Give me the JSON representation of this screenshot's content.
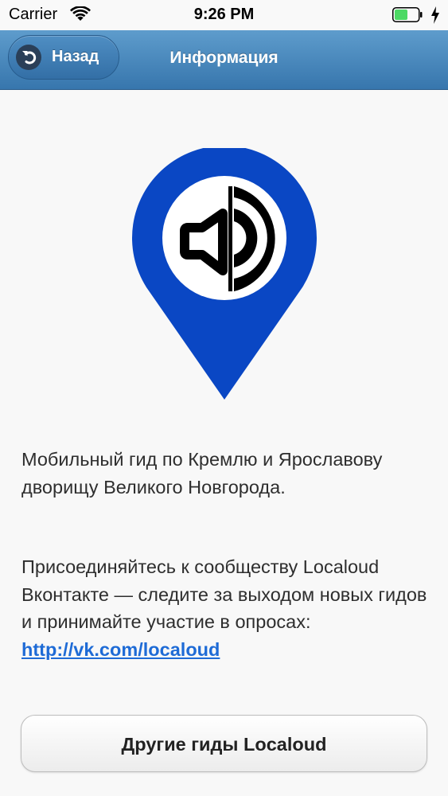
{
  "status_bar": {
    "carrier": "Carrier",
    "time": "9:26 PM",
    "battery_color": "#4cd964"
  },
  "nav": {
    "back_label": "Назад",
    "title": "Информация",
    "bar_color": "#3f7fb6"
  },
  "logo": {
    "pin_color": "#0a47c4",
    "icon": "speaker-icon"
  },
  "content": {
    "paragraph_1": "Мобильный гид по Кремлю и Ярославову дворищу Великого Новгорода.",
    "paragraph_2": "Присоединяйтесь к сообществу Localoud Вконтакте — следите за выходом новых гидов и принимайте участие в опросах:",
    "link": "http://vk.com/localoud",
    "link_color": "#1e6bd6"
  },
  "buttons": {
    "other_guides": "Другие гиды Localoud"
  }
}
